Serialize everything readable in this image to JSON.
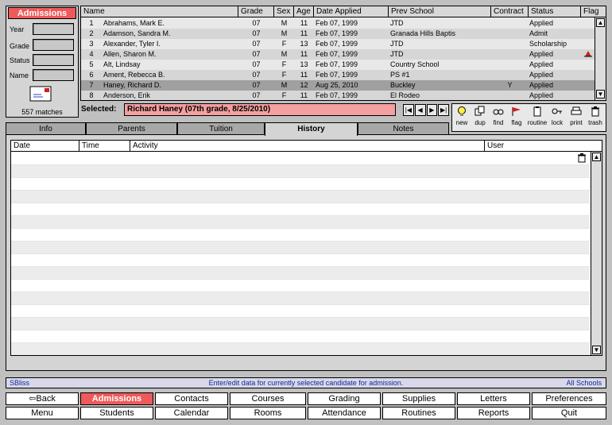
{
  "app": {
    "module_title": "Admissions",
    "filters": [
      {
        "label": "Year",
        "value": ""
      },
      {
        "label": "Grade",
        "value": ""
      },
      {
        "label": "Status",
        "value": ""
      },
      {
        "label": "Name",
        "value": ""
      }
    ],
    "match_count": "557 matches"
  },
  "students": {
    "columns": [
      "Name",
      "Grade",
      "Sex",
      "Age",
      "Date Applied",
      "Prev School",
      "Contract",
      "Status",
      "Flag"
    ],
    "rows": [
      {
        "num": "1",
        "name": "Abrahams, Mark E.",
        "grade": "07",
        "sex": "M",
        "age": "11",
        "date": "Feb 07, 1999",
        "school": "JTD",
        "contract": "",
        "status": "Applied",
        "flag": false
      },
      {
        "num": "2",
        "name": "Adamson, Sandra M.",
        "grade": "07",
        "sex": "M",
        "age": "11",
        "date": "Feb 07, 1999",
        "school": "Granada Hills Baptis",
        "contract": "",
        "status": "Admit",
        "flag": false
      },
      {
        "num": "3",
        "name": "Alexander, Tyler I.",
        "grade": "07",
        "sex": "F",
        "age": "13",
        "date": "Feb 07, 1999",
        "school": "JTD",
        "contract": "",
        "status": "Scholarship",
        "flag": false
      },
      {
        "num": "4",
        "name": "Allen, Sharon M.",
        "grade": "07",
        "sex": "M",
        "age": "11",
        "date": "Feb 07, 1999",
        "school": "JTD",
        "contract": "",
        "status": "Applied",
        "flag": true
      },
      {
        "num": "5",
        "name": "Alt, Lindsay",
        "grade": "07",
        "sex": "F",
        "age": "13",
        "date": "Feb 07, 1999",
        "school": "Country School",
        "contract": "",
        "status": "Applied",
        "flag": false
      },
      {
        "num": "6",
        "name": "Ament, Rebecca B.",
        "grade": "07",
        "sex": "F",
        "age": "11",
        "date": "Feb 07, 1999",
        "school": "PS #1",
        "contract": "",
        "status": "Applied",
        "flag": false
      },
      {
        "num": "7",
        "name": "Haney, Richard D.",
        "grade": "07",
        "sex": "M",
        "age": "12",
        "date": "Aug 25, 2010",
        "school": "Buckley",
        "contract": "Y",
        "status": "Applied",
        "flag": false
      },
      {
        "num": "8",
        "name": "Anderson, Erik",
        "grade": "07",
        "sex": "F",
        "age": "11",
        "date": "Feb 07, 1999",
        "school": "El Rodeo",
        "contract": "",
        "status": "Applied",
        "flag": false
      }
    ]
  },
  "selected": {
    "label": "Selected:",
    "value": "Richard Haney (07th grade, 8/25/2010)"
  },
  "toolbar": [
    "new",
    "dup",
    "find",
    "flag",
    "routine",
    "lock",
    "print",
    "trash"
  ],
  "tabs": [
    "Info",
    "Parents",
    "Tuition",
    "History",
    "Notes"
  ],
  "history": {
    "columns": [
      "Date",
      "Time",
      "Activity",
      "User"
    ]
  },
  "status_bar": {
    "user": "SBliss",
    "message": "Enter/edit data for currently selected candidate for admission.",
    "scope": "All Schools"
  },
  "nav": {
    "row1": [
      "Back",
      "Admissions",
      "Contacts",
      "Courses",
      "Grading",
      "Supplies",
      "Letters",
      "Preferences"
    ],
    "row2": [
      "Menu",
      "Students",
      "Calendar",
      "Rooms",
      "Attendance",
      "Routines",
      "Reports",
      "Quit"
    ]
  },
  "colors": {
    "accent": "#ee5a5a",
    "selected_bg": "#f4a0a0",
    "status_text": "#102a98"
  }
}
